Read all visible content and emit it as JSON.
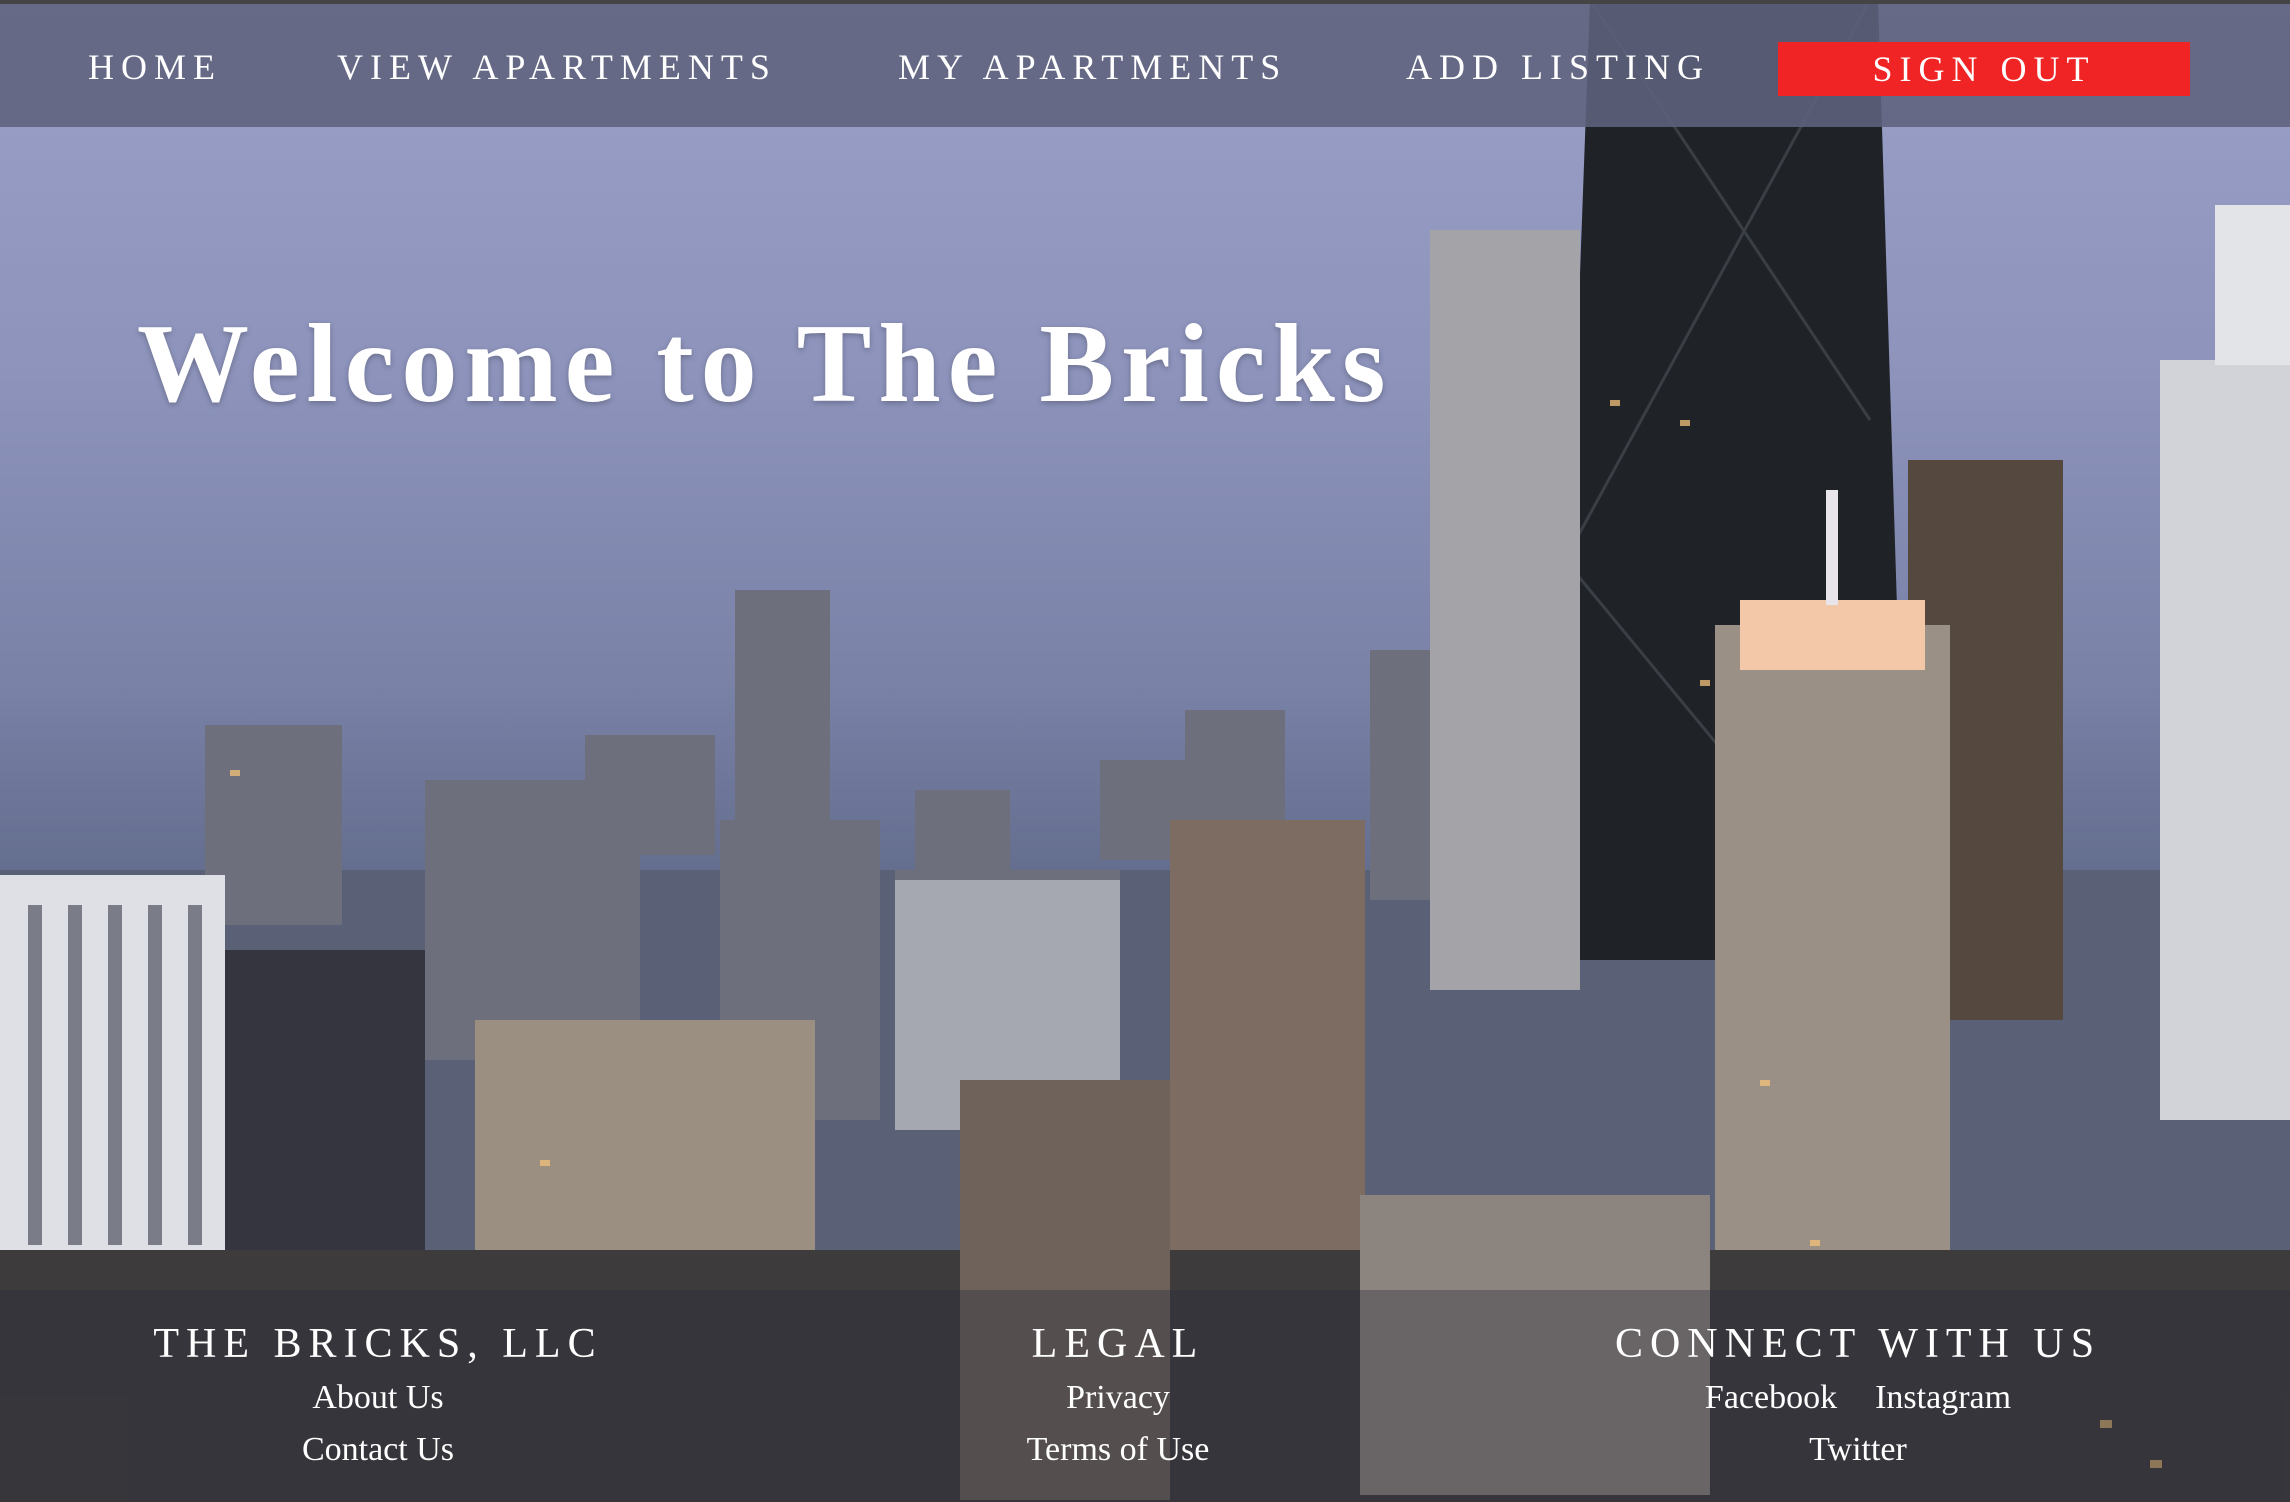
{
  "nav": {
    "home": "HOME",
    "view_apartments": "VIEW APARTMENTS",
    "my_apartments": "MY APARTMENTS",
    "add_listing": "ADD LISTING",
    "sign_out": "SIGN OUT"
  },
  "hero": {
    "title": "Welcome to The Bricks"
  },
  "footer": {
    "company": {
      "heading": "THE BRICKS, LLC",
      "links": [
        "About Us",
        "Contact Us"
      ]
    },
    "legal": {
      "heading": "LEGAL",
      "links": [
        "Privacy",
        "Terms of Use"
      ]
    },
    "connect": {
      "heading": "CONNECT WITH US",
      "links": [
        "Facebook",
        "Instagram",
        "Twitter"
      ]
    }
  },
  "colors": {
    "sign_out_bg": "#f02424",
    "nav_bg": "#5f627d",
    "text": "#ffffff"
  }
}
